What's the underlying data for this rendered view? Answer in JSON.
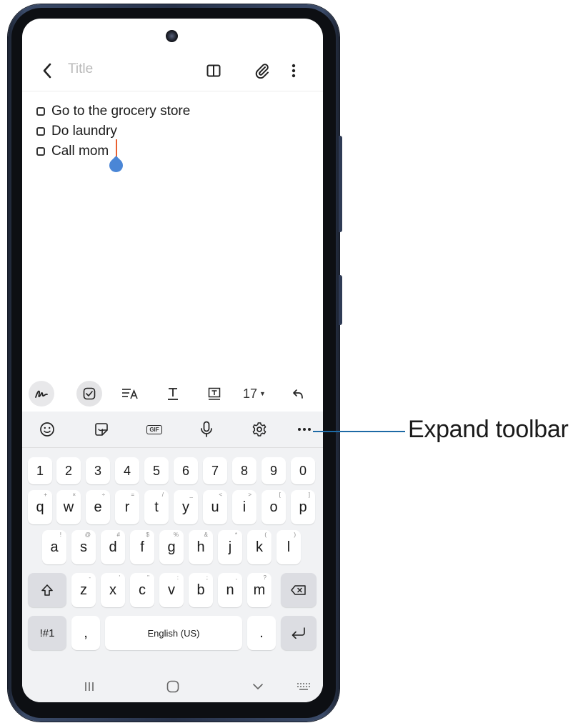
{
  "app": {
    "title_placeholder": "Title",
    "icons": [
      "chevron-left-icon",
      "book-icon",
      "paperclip-icon",
      "more-vertical-icon"
    ]
  },
  "note": {
    "items": [
      {
        "text": "Go to the grocery store",
        "checked": false
      },
      {
        "text": "Do laundry",
        "checked": false
      },
      {
        "text": "Call mom",
        "checked": false
      }
    ]
  },
  "edit_toolbar": {
    "font_size": "17",
    "icons": [
      "handwriting-icon",
      "checkbox-icon",
      "text-style-icon",
      "text-format-icon",
      "text-box-icon",
      "font-size-dropdown",
      "undo-icon"
    ]
  },
  "keyboard_toolbar": {
    "gif_label": "GIF",
    "icons": [
      "emoji-icon",
      "sticker-icon",
      "gif-icon",
      "mic-icon",
      "settings-icon",
      "more-horizontal-icon"
    ]
  },
  "keyboard": {
    "number_row": [
      "1",
      "2",
      "3",
      "4",
      "5",
      "6",
      "7",
      "8",
      "9",
      "0"
    ],
    "row1": [
      {
        "key": "q",
        "sub": "+"
      },
      {
        "key": "w",
        "sub": "×"
      },
      {
        "key": "e",
        "sub": "÷"
      },
      {
        "key": "r",
        "sub": "="
      },
      {
        "key": "t",
        "sub": "/"
      },
      {
        "key": "y",
        "sub": "_"
      },
      {
        "key": "u",
        "sub": "<"
      },
      {
        "key": "i",
        "sub": ">"
      },
      {
        "key": "o",
        "sub": "["
      },
      {
        "key": "p",
        "sub": "]"
      }
    ],
    "row2": [
      {
        "key": "a",
        "sub": "!"
      },
      {
        "key": "s",
        "sub": "@"
      },
      {
        "key": "d",
        "sub": "#"
      },
      {
        "key": "f",
        "sub": "$"
      },
      {
        "key": "g",
        "sub": "%"
      },
      {
        "key": "h",
        "sub": "&"
      },
      {
        "key": "j",
        "sub": "*"
      },
      {
        "key": "k",
        "sub": "("
      },
      {
        "key": "l",
        "sub": ")"
      }
    ],
    "row3": [
      {
        "key": "z",
        "sub": "-"
      },
      {
        "key": "x",
        "sub": "'"
      },
      {
        "key": "c",
        "sub": "\""
      },
      {
        "key": "v",
        "sub": ":"
      },
      {
        "key": "b",
        "sub": ";"
      },
      {
        "key": "n",
        "sub": ","
      },
      {
        "key": "m",
        "sub": "?"
      }
    ],
    "symbols_label": "!#1",
    "comma": ",",
    "space_label": "English (US)",
    "period": "."
  },
  "callout": {
    "label": "Expand toolbar",
    "color": "#1d6aa5"
  },
  "colors": {
    "cursor": "#e9602f",
    "cursor_handle": "#4a86d6",
    "keyboard_bg": "#f1f2f4",
    "phone_frame": "#27324a"
  }
}
